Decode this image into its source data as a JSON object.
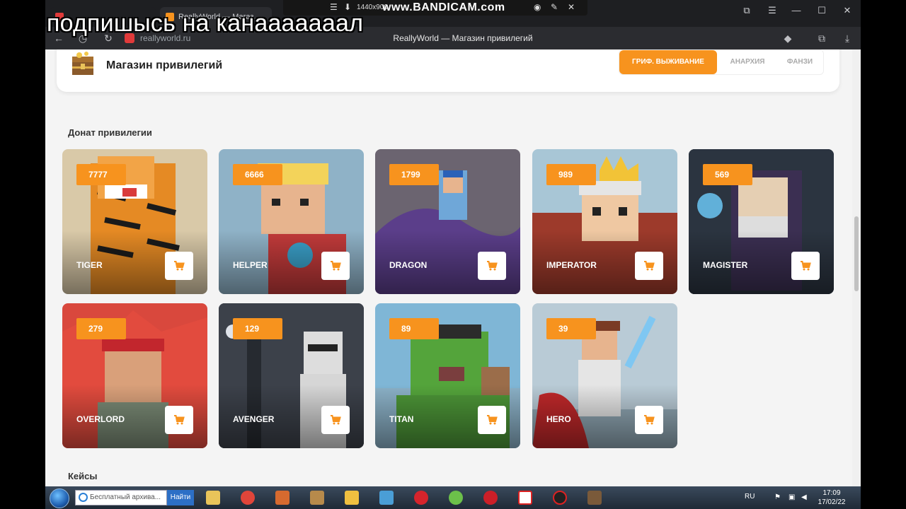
{
  "overlay_caption": "подпишысь на канааааааал",
  "browser": {
    "tabs": [
      {
        "label": "",
        "favicon_color": "#e03a3a"
      },
      {
        "label": "ReallyWorld — Магаз…",
        "favicon_color": "#f7931e"
      }
    ],
    "address": "reallyworld.ru",
    "page_title": "ReallyWorld — Магазин привилегий",
    "window_controls": [
      "⧉",
      "☰",
      "—",
      "☐",
      "✕"
    ]
  },
  "recorder": {
    "resolution": "1440x900",
    "brand": "www.BANDICAM.com"
  },
  "shop": {
    "title": "Магазин привилегий",
    "server_tabs": [
      "ГРИФ. ВЫЖИВАНИЕ",
      "АНАРХИЯ",
      "ФАНЗИ"
    ],
    "active_server_tab": 0
  },
  "section_title": "Донат привилегии",
  "privileges": [
    {
      "name": "TIGER",
      "price": "7777",
      "bg": "#d9c9a8",
      "art": "tiger"
    },
    {
      "name": "HELPER",
      "price": "6666",
      "bg": "#8fb2c7",
      "art": "helper"
    },
    {
      "name": "DRAGON",
      "price": "1799",
      "bg": "#6b6470",
      "art": "dragon"
    },
    {
      "name": "IMPERATOR",
      "price": "989",
      "bg": "#a8c6d6",
      "art": "imperator"
    },
    {
      "name": "MAGISTER",
      "price": "569",
      "bg": "#2e3a46",
      "art": "magister"
    },
    {
      "name": "OVERLORD",
      "price": "279",
      "bg": "#d9483d",
      "art": "overlord"
    },
    {
      "name": "AVENGER",
      "price": "129",
      "bg": "#3b3f47",
      "art": "avenger"
    },
    {
      "name": "TITAN",
      "price": "89",
      "bg": "#7fb6d6",
      "art": "titan"
    },
    {
      "name": "HERO",
      "price": "39",
      "bg": "#b9cbd6",
      "art": "hero"
    }
  ],
  "cases_title": "Кейсы",
  "taskbar": {
    "search_text": "Бесплатный архива...",
    "search_button": "Найти",
    "lang": "RU",
    "time": "17:09",
    "date": "17/02/22",
    "apps": [
      "explorer",
      "chrome",
      "app",
      "archive",
      "app2",
      "media",
      "opera",
      "utorrent",
      "opera2",
      "yandex",
      "bandicam",
      "minecraft"
    ]
  }
}
